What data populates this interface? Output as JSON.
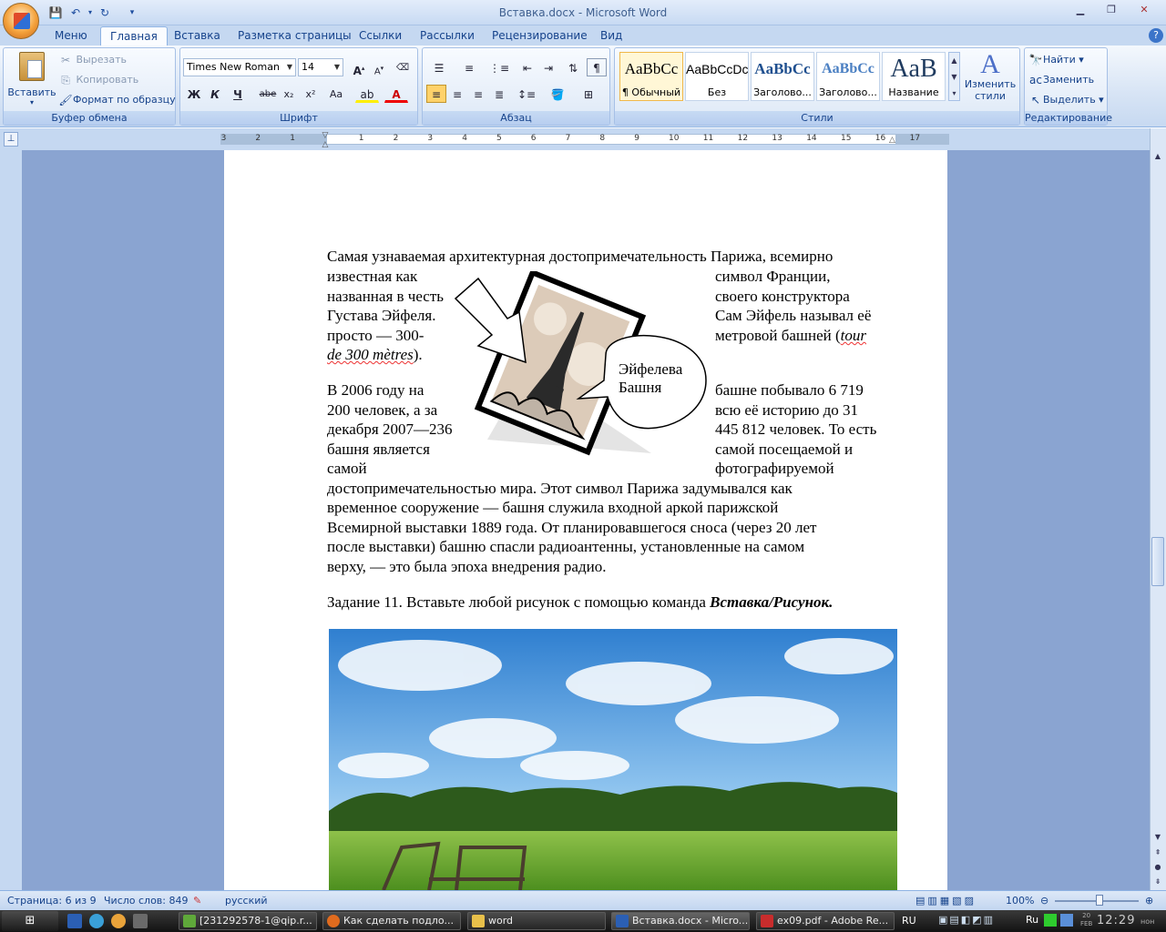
{
  "window": {
    "title": "Вставка.docx - Microsoft Word"
  },
  "quick_access": {
    "save_icon": "save-icon",
    "undo_icon": "undo-icon",
    "redo_icon": "redo-icon"
  },
  "tabs": [
    {
      "label": "Меню"
    },
    {
      "label": "Главная"
    },
    {
      "label": "Вставка"
    },
    {
      "label": "Разметка страницы"
    },
    {
      "label": "Ссылки"
    },
    {
      "label": "Рассылки"
    },
    {
      "label": "Рецензирование"
    },
    {
      "label": "Вид"
    }
  ],
  "clipboard": {
    "paste": "Вставить",
    "cut": "Вырезать",
    "copy": "Копировать",
    "format_painter": "Формат по образцу",
    "label": "Буфер обмена"
  },
  "font": {
    "name": "Times New Roman",
    "size": "14",
    "label": "Шрифт",
    "bold": "Ж",
    "italic": "К",
    "underline": "Ч",
    "strike": "abe",
    "sub": "x₂",
    "sup": "x²",
    "case": "Aa",
    "grow": "A",
    "shrink": "A"
  },
  "paragraph": {
    "label": "Абзац"
  },
  "styles": {
    "label": "Стили",
    "items": [
      {
        "sample": "AaBbCc",
        "name": "¶ Обычный"
      },
      {
        "sample": "AaBbCcDc",
        "name": "Без интер..."
      },
      {
        "sample": "AaBbCc",
        "name": "Заголово..."
      },
      {
        "sample": "AaBbCc",
        "name": "Заголово..."
      },
      {
        "sample": "AaB",
        "name": "Название"
      }
    ],
    "change": "Изменить стили"
  },
  "editing": {
    "find": "Найти",
    "replace": "Заменить",
    "select": "Выделить",
    "label": "Редактирование"
  },
  "ruler": {
    "numbers": [
      "3",
      "2",
      "1",
      "1",
      "2",
      "3",
      "4",
      "5",
      "6",
      "7",
      "8",
      "9",
      "10",
      "11",
      "12",
      "13",
      "14",
      "15",
      "16",
      "17"
    ]
  },
  "document": {
    "para1_line1": "Самая узнаваемая архитектурная достопримечательность Парижа, всемирно",
    "para1_l2a": "известная как",
    "para1_l2b": "символ Франции,",
    "para1_l3a": "названная в честь",
    "para1_l3b": "своего конструктора",
    "para1_l4a": "Густава Эйфеля.",
    "para1_l4b": "Сам Эйфель называл её",
    "para1_l5a": "просто — 300-",
    "para1_l5b": "метровой башней (",
    "para1_l5c": "tour",
    "para1_l6a": "de 300 mètres",
    "para1_l6b": ").",
    "para2_l1a": "В 2006 году на",
    "para2_l1b": "башне побывало 6 719",
    "para2_l2a": "200 человек, а за",
    "para2_l2b": "всю её историю до 31",
    "para2_l3a": "декабря 2007—236",
    "para2_l3b": "445 812 человек. То есть",
    "para2_l4a": "башня является",
    "para2_l4b": "самой посещаемой и",
    "para2_l5a": "самой",
    "para2_l5b": "фотографируемой",
    "para2_l6": "достопримечательностью мира. Этот символ Парижа задумывался как",
    "para2_l7": "временное сооружение — башня служила входной аркой парижской",
    "para2_l8": "Всемирной выставки 1889 года. От планировавшегося сноса (через 20 лет",
    "para2_l9": "после выставки) башню спасли радиоантенны, установленные на самом",
    "para2_l10": "верху, — это была эпоха внедрения радио.",
    "task_prefix": "Задание 11. Вставьте любой рисунок с помощью команда ",
    "task_bold": "Вставка/Рисунок.",
    "callout": "Эйфелева Башня"
  },
  "status": {
    "page": "Страница: 6 из 9",
    "words": "Число слов: 849",
    "lang": "русский",
    "zoom": "100%"
  },
  "taskbar": {
    "items": [
      {
        "label": "[231292578-1@qip.r..."
      },
      {
        "label": "Как сделать подло..."
      },
      {
        "label": "word"
      },
      {
        "label": "Вставка.docx - Micro..."
      },
      {
        "label": "ex09.pdf - Adobe Re..."
      }
    ],
    "lang": "RU",
    "lang2": "Ru",
    "time": "12:29",
    "date_day": "20",
    "date_month": "FEB",
    "day_suffix": "нон"
  }
}
